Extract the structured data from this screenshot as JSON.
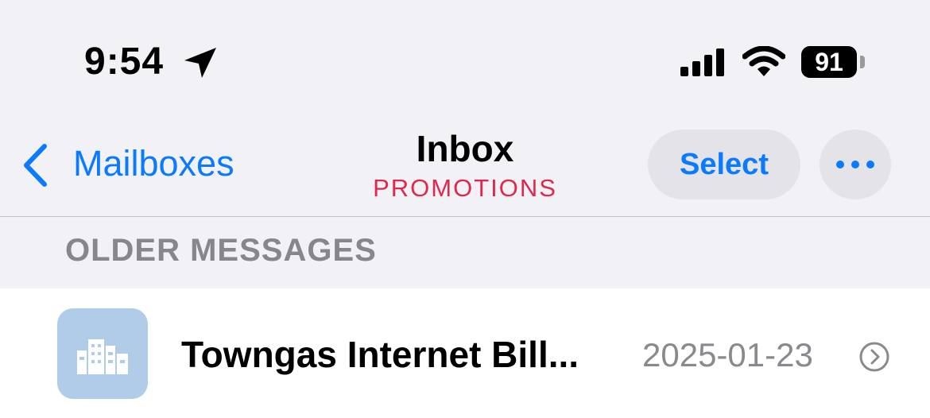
{
  "status_bar": {
    "time": "9:54",
    "battery": "91",
    "icons": [
      "location-arrow-icon",
      "cellular-signal-icon",
      "wifi-icon",
      "battery-icon"
    ]
  },
  "nav": {
    "back_label": "Mailboxes",
    "title": "Inbox",
    "subtitle": "PROMOTIONS",
    "select_label": "Select",
    "more_icon": "ellipsis-icon"
  },
  "section": {
    "header": "OLDER MESSAGES"
  },
  "messages": [
    {
      "sender": "Towngas Internet Bill...",
      "date": "2025-01-23",
      "avatar_icon": "building-icon"
    }
  ],
  "colors": {
    "accent": "#0a7aff",
    "subtitle": "#e0284d",
    "background_top": "#f2f2f6",
    "avatar": "#b0cce9",
    "secondary_text": "#8a8a8e"
  }
}
